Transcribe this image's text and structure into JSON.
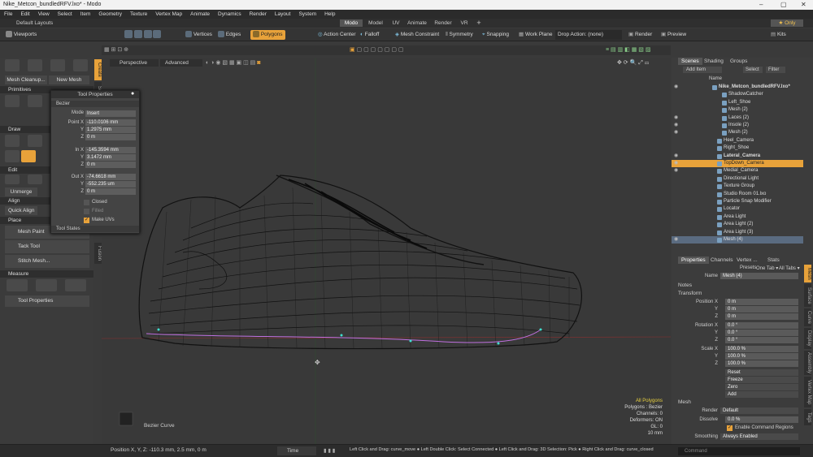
{
  "window": {
    "title": "Nike_Metcon_bundledRFV.lxo* - Modo"
  },
  "menu": [
    "File",
    "Edit",
    "View",
    "Select",
    "Item",
    "Geometry",
    "Texture",
    "Vertex Map",
    "Animate",
    "Dynamics",
    "Render",
    "Layout",
    "System",
    "Help"
  ],
  "layout_bar": {
    "left": "Default Layouts",
    "tabs": [
      "Modo",
      "Model",
      "UV",
      "Animate",
      "Render",
      "VR"
    ],
    "active_tab": "Modo",
    "right": "★ Only"
  },
  "toolbar": {
    "viewports": "Viewports",
    "vertices": "Vertices",
    "edges": "Edges",
    "polygons": "Polygons",
    "action_center": "Action Center",
    "falloff": "Falloff",
    "mesh_constraint": "Mesh Constraint",
    "symmetry": "Symmetry",
    "snapping": "Snapping",
    "work_plane": "Work Plane",
    "drop_action": "Drop Action: (none)",
    "render": "Render",
    "preview": "Preview",
    "kits": "Kits"
  },
  "left_panel": {
    "mesh_cleanup": "Mesh Cleanup...",
    "new_mesh": "New Mesh",
    "sections": {
      "primitives": "Primitives",
      "draw": "Draw",
      "edit": "Edit",
      "align": "Align",
      "place": "Place",
      "measure": "Measure"
    },
    "unmerge": "Unmerge",
    "quick_align": "Quick Align",
    "mesh_paint": "Mesh Paint",
    "tack_tool": "Tack Tool",
    "stitch_mesh": "Stitch Mesh...",
    "tool_properties": "Tool Properties",
    "vtabs": [
      "Create",
      "Sculpt",
      "Fusion"
    ]
  },
  "tool_properties": {
    "title": "Tool Properties",
    "section": "Bezier",
    "mode_label": "Mode",
    "mode_value": "Insert",
    "point_label": "Point X",
    "point": [
      "-110.0106 mm",
      "1.2975 mm",
      "0 m"
    ],
    "in_label": "In X",
    "in": [
      "-145.3594 mm",
      "3.1472 mm",
      "0 m"
    ],
    "out_label": "Out X",
    "out": [
      "-74.6618 mm",
      "-552.235 um",
      "0 m"
    ],
    "y": "Y",
    "z": "Z",
    "closed": "Closed",
    "filled": "Filled",
    "make_uvs": "Make UVs",
    "tool_states": "Tool States"
  },
  "viewport": {
    "perspective": "Perspective",
    "advanced": "Advanced",
    "tool_name": "Bezier Curve",
    "info": [
      "All Polygons",
      "Polygons : Bezier",
      "Channels: 0",
      "Deformers: ON",
      "GL: 0",
      "10 mm"
    ]
  },
  "scene": {
    "tabs": [
      "Scenes",
      "Shading",
      "Groups"
    ],
    "add_item": "Add Item",
    "select": "Select",
    "filter": "Filter",
    "name_col": "Name",
    "items": [
      {
        "name": "Nike_Metcon_bundledRFV.lxo*",
        "indent": 0,
        "eye": "◉",
        "bold": true
      },
      {
        "name": "ShadowCatcher",
        "indent": 2,
        "eye": ""
      },
      {
        "name": "Left_Shoe",
        "indent": 2,
        "eye": ""
      },
      {
        "name": "Mesh (2)",
        "indent": 2,
        "eye": ""
      },
      {
        "name": "Laces (2)",
        "indent": 2,
        "eye": "◉"
      },
      {
        "name": "Insole (2)",
        "indent": 2,
        "eye": "◉"
      },
      {
        "name": "Mesh (2)",
        "indent": 2,
        "eye": "◉"
      },
      {
        "name": "Heel_Camera",
        "indent": 1,
        "eye": ""
      },
      {
        "name": "Right_Shoe",
        "indent": 1,
        "eye": ""
      },
      {
        "name": "Lateral_Camera",
        "indent": 1,
        "eye": "◉",
        "bold": true
      },
      {
        "name": "TopDown_Camera",
        "indent": 1,
        "eye": "◉",
        "highlight": true
      },
      {
        "name": "Medial_Camera",
        "indent": 1,
        "eye": "◉"
      },
      {
        "name": "Directional Light",
        "indent": 1,
        "eye": ""
      },
      {
        "name": "Texture Group",
        "indent": 1,
        "eye": ""
      },
      {
        "name": "Studio Room 01.lxo",
        "indent": 1,
        "eye": ""
      },
      {
        "name": "Particle Snap Modifier",
        "indent": 1,
        "eye": ""
      },
      {
        "name": "Locator",
        "indent": 1,
        "eye": ""
      },
      {
        "name": "Area Light",
        "indent": 1,
        "eye": ""
      },
      {
        "name": "Area Light (2)",
        "indent": 1,
        "eye": ""
      },
      {
        "name": "Area Light (3)",
        "indent": 1,
        "eye": ""
      },
      {
        "name": "Mesh (4)",
        "indent": 1,
        "eye": "◉",
        "selected": true
      }
    ]
  },
  "properties": {
    "tabs": [
      "Properties",
      "Channels",
      "Vertex ...",
      "Stats"
    ],
    "presets": "Presets",
    "one_tab": "One Tab ▾",
    "all_tabs": "All Tabs ▾",
    "name_label": "Name",
    "name_value": "Mesh (4)",
    "notes": "Notes",
    "transform": "Transform",
    "position_label": "Position X",
    "position": [
      "0 m",
      "0 m",
      "0 m"
    ],
    "rotation_label": "Rotation X",
    "rotation": [
      "0.0 °",
      "0.0 °",
      "0.0 °"
    ],
    "scale_label": "Scale X",
    "scale": [
      "100.0 %",
      "100.0 %",
      "100.0 %"
    ],
    "y": "Y",
    "z": "Z",
    "buttons": [
      "Reset",
      "Freeze",
      "Zero",
      "Add"
    ],
    "mesh": "Mesh",
    "render_label": "Render",
    "render_value": "Default",
    "dissolve_label": "Dissolve",
    "dissolve_value": "0.0 %",
    "enable_cmd": "Enable Command Regions",
    "smoothing_label": "Smoothing",
    "smoothing_value": "Always Enabled",
    "vtabs": [
      "Mesh",
      "Surface",
      "Curve",
      "Display",
      "Assembly",
      "Vertex Map",
      "Tags"
    ]
  },
  "status": {
    "position": "Position X, Y, Z:  -110.3 mm, 2.5 mm, 0 m",
    "time": "Time",
    "hints": "Left Click and Drag: curve_move ● Left Double Click: Select Connected ● Left Click and Drag: 3D Selection: Pick ● Right Click and Drag: curve_closed",
    "command": "Command"
  }
}
